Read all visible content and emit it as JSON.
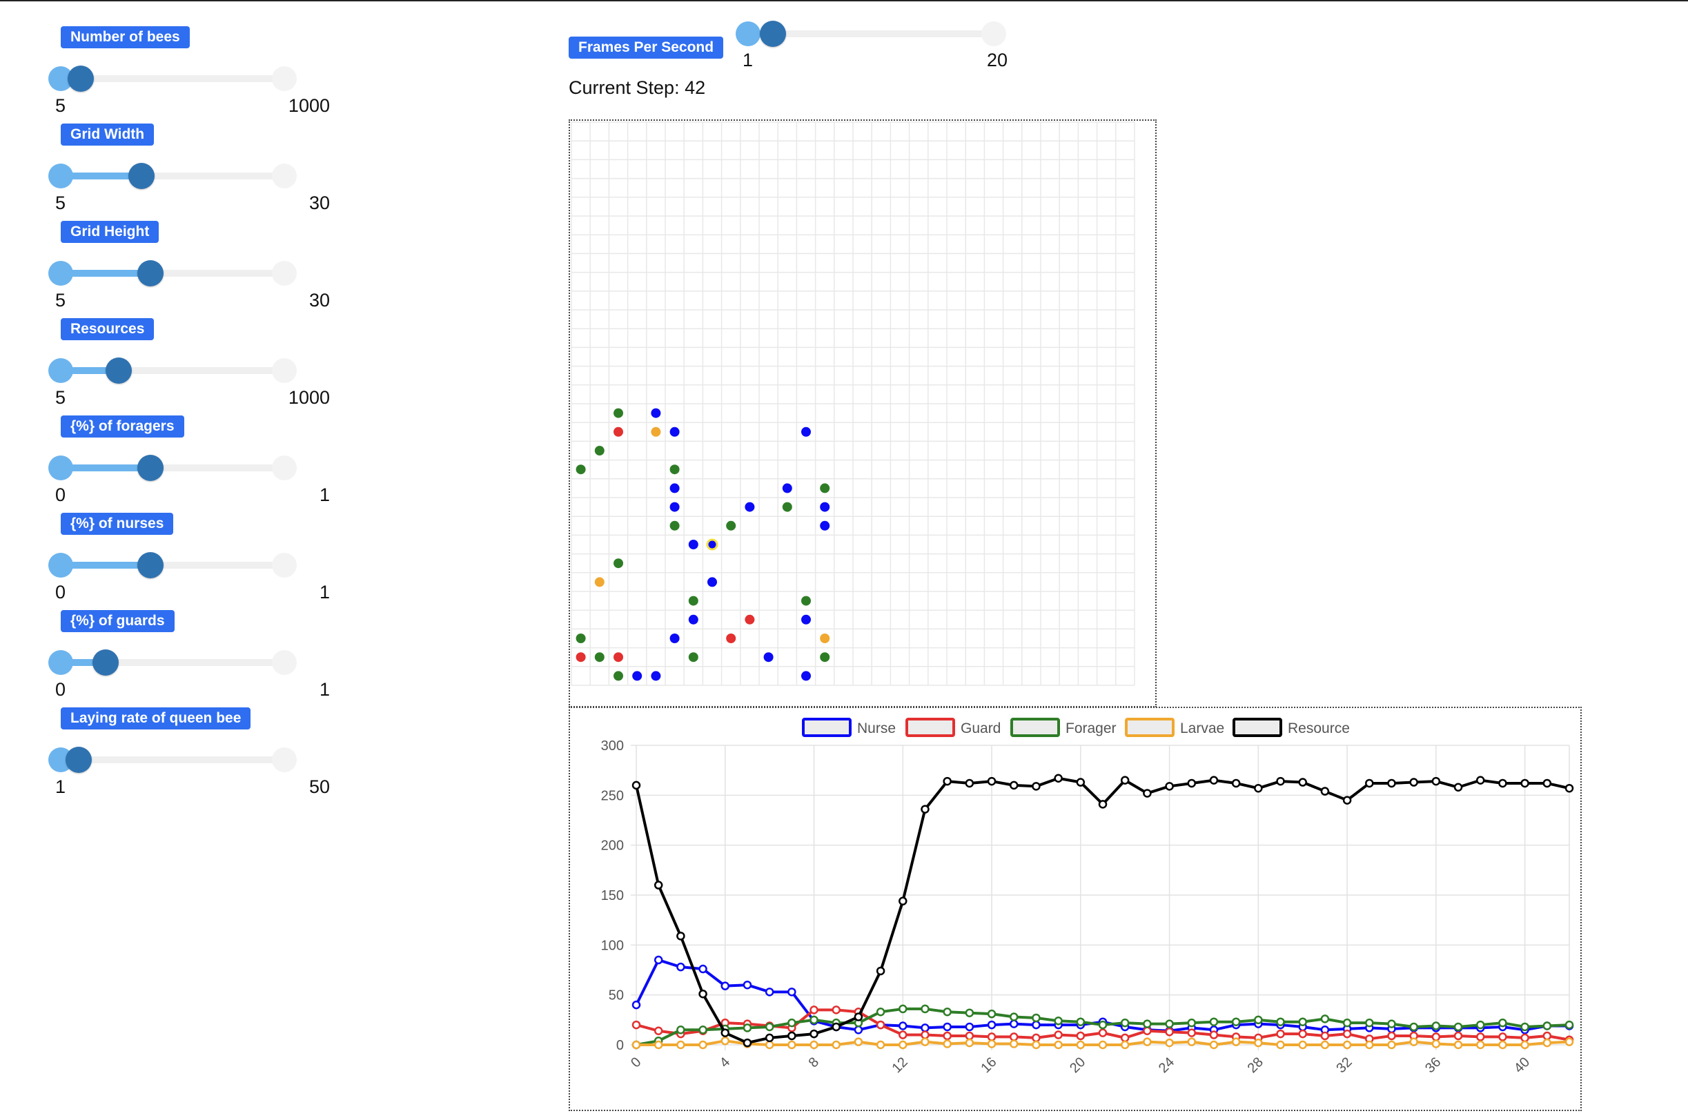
{
  "sliders": [
    {
      "label": "Number of bees",
      "min": "5",
      "max": "1000",
      "fraction": 0.09
    },
    {
      "label": "Grid Width",
      "min": "5",
      "max": "30",
      "fraction": 0.36
    },
    {
      "label": "Grid Height",
      "min": "5",
      "max": "30",
      "fraction": 0.4
    },
    {
      "label": "Resources",
      "min": "5",
      "max": "1000",
      "fraction": 0.26
    },
    {
      "label": "{%} of foragers",
      "min": "0",
      "max": "1",
      "fraction": 0.4
    },
    {
      "label": "{%} of nurses",
      "min": "0",
      "max": "1",
      "fraction": 0.4
    },
    {
      "label": "{%} of guards",
      "min": "0",
      "max": "1",
      "fraction": 0.2
    },
    {
      "label": "Laying rate of queen bee",
      "min": "1",
      "max": "50",
      "fraction": 0.08
    }
  ],
  "fps": {
    "label": "Frames Per Second",
    "min": "1",
    "max": "20",
    "fraction": 0.1
  },
  "current_step_label": "Current Step: 42",
  "grid": {
    "columns": 30,
    "rows": 30,
    "line_color": "#e8e8e8",
    "bee_colors": {
      "Nurse": "#0b0bf5",
      "Guard": "#e33030",
      "Forager": "#2e7d26",
      "Larvae": "#f0a830"
    },
    "bees": [
      {
        "c": 2,
        "r": 15,
        "type": "Forager"
      },
      {
        "c": 4,
        "r": 15,
        "type": "Nurse"
      },
      {
        "c": 2,
        "r": 16,
        "type": "Guard"
      },
      {
        "c": 4,
        "r": 16,
        "type": "Larvae"
      },
      {
        "c": 5,
        "r": 16,
        "type": "Nurse"
      },
      {
        "c": 12,
        "r": 16,
        "type": "Nurse"
      },
      {
        "c": 1,
        "r": 17,
        "type": "Forager"
      },
      {
        "c": 0,
        "r": 18,
        "type": "Forager"
      },
      {
        "c": 5,
        "r": 18,
        "type": "Forager"
      },
      {
        "c": 5,
        "r": 19,
        "type": "Nurse"
      },
      {
        "c": 11,
        "r": 19,
        "type": "Nurse"
      },
      {
        "c": 13,
        "r": 19,
        "type": "Forager"
      },
      {
        "c": 5,
        "r": 20,
        "type": "Nurse"
      },
      {
        "c": 9,
        "r": 20,
        "type": "Nurse"
      },
      {
        "c": 11,
        "r": 20,
        "type": "Forager"
      },
      {
        "c": 13,
        "r": 20,
        "type": "Nurse"
      },
      {
        "c": 5,
        "r": 21,
        "type": "Forager"
      },
      {
        "c": 8,
        "r": 21,
        "type": "Forager"
      },
      {
        "c": 13,
        "r": 21,
        "type": "Nurse"
      },
      {
        "c": 6,
        "r": 22,
        "type": "Nurse"
      },
      {
        "c": 7,
        "r": 22,
        "type": "Nurse",
        "ring": "#f0e040"
      },
      {
        "c": 2,
        "r": 23,
        "type": "Forager"
      },
      {
        "c": 1,
        "r": 24,
        "type": "Larvae"
      },
      {
        "c": 7,
        "r": 24,
        "type": "Nurse"
      },
      {
        "c": 6,
        "r": 25,
        "type": "Forager"
      },
      {
        "c": 12,
        "r": 25,
        "type": "Forager"
      },
      {
        "c": 6,
        "r": 26,
        "type": "Nurse"
      },
      {
        "c": 9,
        "r": 26,
        "type": "Guard"
      },
      {
        "c": 12,
        "r": 26,
        "type": "Nurse"
      },
      {
        "c": 0,
        "r": 27,
        "type": "Forager"
      },
      {
        "c": 5,
        "r": 27,
        "type": "Nurse"
      },
      {
        "c": 8,
        "r": 27,
        "type": "Guard"
      },
      {
        "c": 13,
        "r": 27,
        "type": "Larvae"
      },
      {
        "c": 0,
        "r": 28,
        "type": "Guard"
      },
      {
        "c": 1,
        "r": 28,
        "type": "Forager"
      },
      {
        "c": 2,
        "r": 28,
        "type": "Guard"
      },
      {
        "c": 6,
        "r": 28,
        "type": "Forager"
      },
      {
        "c": 10,
        "r": 28,
        "type": "Nurse"
      },
      {
        "c": 13,
        "r": 28,
        "type": "Forager"
      },
      {
        "c": 2,
        "r": 29,
        "type": "Forager"
      },
      {
        "c": 3,
        "r": 29,
        "type": "Nurse"
      },
      {
        "c": 4,
        "r": 29,
        "type": "Nurse"
      },
      {
        "c": 12,
        "r": 29,
        "type": "Nurse"
      }
    ]
  },
  "chart_data": {
    "type": "line",
    "x": [
      0,
      1,
      2,
      3,
      4,
      5,
      6,
      7,
      8,
      9,
      10,
      11,
      12,
      13,
      14,
      15,
      16,
      17,
      18,
      19,
      20,
      21,
      22,
      23,
      24,
      25,
      26,
      27,
      28,
      29,
      30,
      31,
      32,
      33,
      34,
      35,
      36,
      37,
      38,
      39,
      40,
      41,
      42
    ],
    "x_tick_labels": [
      "0",
      "4",
      "8",
      "12",
      "16",
      "20",
      "24",
      "28",
      "32",
      "36",
      "40"
    ],
    "x_tick_values": [
      0,
      4,
      8,
      12,
      16,
      20,
      24,
      28,
      32,
      36,
      40
    ],
    "y_ticks": [
      "0",
      "50",
      "100",
      "150",
      "200",
      "250",
      "300"
    ],
    "ylim": [
      0,
      300
    ],
    "xlim": [
      0,
      42
    ],
    "legend_position": "top",
    "grid": true,
    "series": [
      {
        "name": "Nurse",
        "color": "#0b0bf5",
        "values": [
          40,
          85,
          78,
          76,
          59,
          60,
          53,
          53,
          24,
          18,
          15,
          20,
          19,
          17,
          18,
          18,
          20,
          21,
          20,
          20,
          20,
          23,
          18,
          15,
          14,
          17,
          15,
          20,
          21,
          20,
          18,
          15,
          16,
          17,
          16,
          17,
          17,
          17,
          17,
          18,
          15,
          19,
          19
        ]
      },
      {
        "name": "Guard",
        "color": "#e33030",
        "values": [
          20,
          14,
          11,
          14,
          22,
          21,
          19,
          17,
          35,
          35,
          33,
          20,
          10,
          10,
          9,
          9,
          8,
          8,
          7,
          10,
          9,
          12,
          7,
          14,
          13,
          12,
          10,
          8,
          7,
          11,
          11,
          9,
          11,
          6,
          9,
          9,
          8,
          9,
          8,
          8,
          7,
          9,
          5
        ]
      },
      {
        "name": "Forager",
        "color": "#2e7d26",
        "values": [
          0,
          4,
          15,
          15,
          16,
          17,
          18,
          22,
          25,
          22,
          22,
          33,
          36,
          36,
          33,
          32,
          31,
          28,
          27,
          24,
          23,
          20,
          22,
          21,
          21,
          22,
          23,
          23,
          25,
          23,
          23,
          26,
          22,
          22,
          21,
          18,
          19,
          18,
          20,
          22,
          18,
          19,
          20
        ]
      },
      {
        "name": "Larvae",
        "color": "#f0a830",
        "values": [
          0,
          0,
          0,
          0,
          4,
          1,
          0,
          0,
          0,
          0,
          3,
          0,
          0,
          3,
          1,
          2,
          1,
          1,
          0,
          0,
          0,
          0,
          0,
          3,
          2,
          3,
          0,
          3,
          2,
          0,
          0,
          0,
          0,
          0,
          0,
          3,
          1,
          0,
          0,
          0,
          0,
          2,
          3
        ]
      },
      {
        "name": "Resource",
        "color": "#000000",
        "values": [
          260,
          160,
          109,
          51,
          12,
          2,
          7,
          9,
          11,
          18,
          28,
          74,
          144,
          236,
          264,
          262,
          264,
          260,
          259,
          267,
          263,
          241,
          265,
          252,
          259,
          262,
          265,
          262,
          257,
          264,
          263,
          254,
          245,
          262,
          262,
          263,
          264,
          258,
          265,
          262,
          262,
          262,
          257
        ]
      }
    ]
  }
}
